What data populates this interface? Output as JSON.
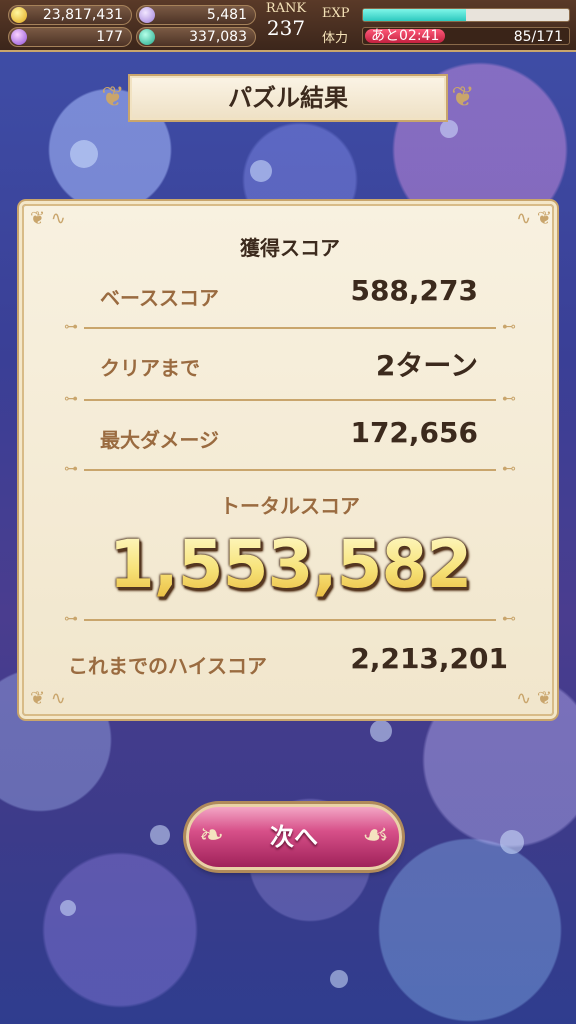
{
  "status_bar": {
    "gold": "23,817,431",
    "feather": "5,481",
    "gem": "177",
    "coin": "337,083",
    "rank_label": "RANK",
    "rank_value": "237",
    "exp_label": "EXP",
    "exp_progress": 0.5,
    "stamina_label": "体力",
    "stamina_timer": "あと02:41",
    "stamina_value": "85/171"
  },
  "header": {
    "title": "パズル結果"
  },
  "results": {
    "section_title": "獲得スコア",
    "base_score_label": "ベーススコア",
    "base_score_value": "588,273",
    "clear_label": "クリアまで",
    "clear_value": "2ターン",
    "max_damage_label": "最大ダメージ",
    "max_damage_value": "172,656",
    "total_label": "トータルスコア",
    "total_value": "1,553,582",
    "high_score_label": "これまでのハイスコア",
    "high_score_value": "2,213,201"
  },
  "next_button": {
    "label": "次へ"
  },
  "colors": {
    "accent_gold": "#c9a56c",
    "label_brown": "#9a6b40",
    "button_pink": "#d75089"
  }
}
